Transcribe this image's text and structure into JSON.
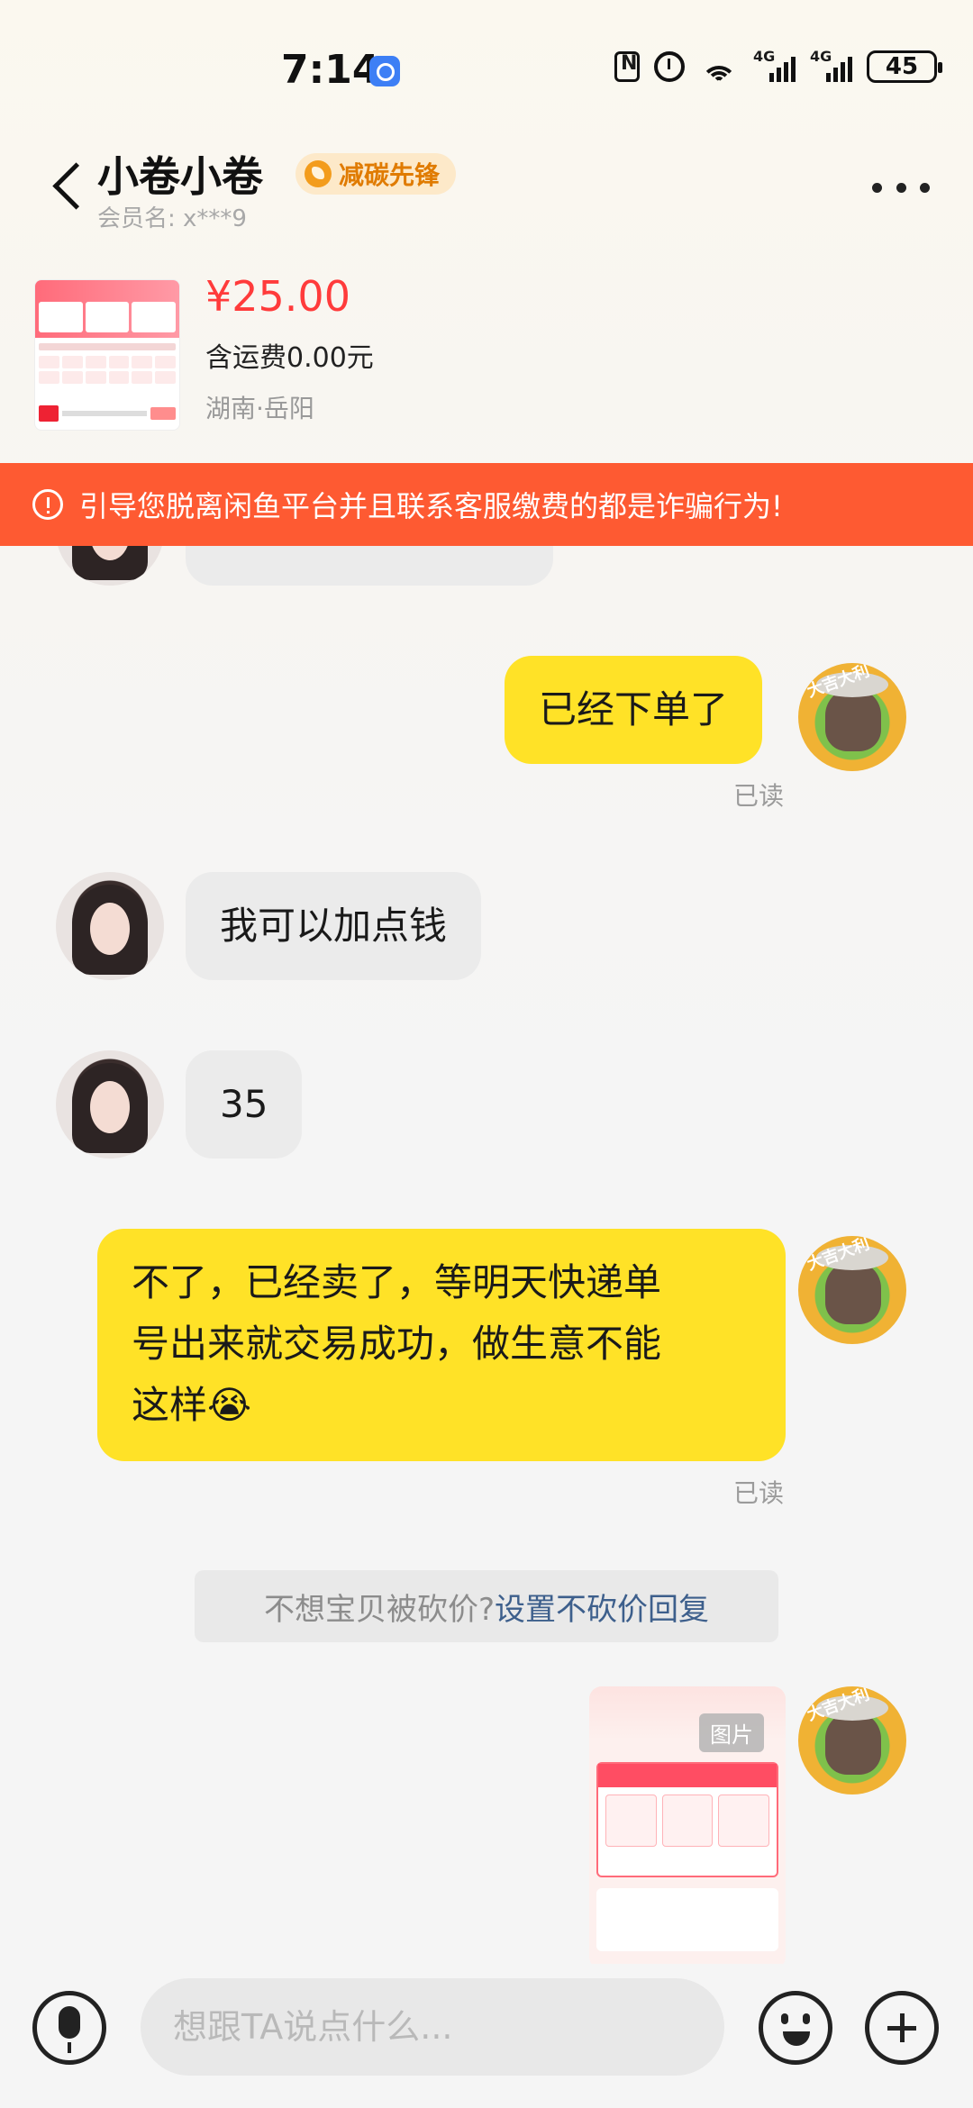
{
  "status_bar": {
    "time": "7:14",
    "signal1_label": "4G",
    "signal2_label": "4G",
    "wifi_label": "6",
    "battery": "45"
  },
  "header": {
    "seller_name": "小卷小卷",
    "badge": "减碳先锋",
    "member_label": "会员名:  x***9"
  },
  "product": {
    "price": "¥25.00",
    "shipping": "含运费0.00元",
    "location": "湖南·岳阳"
  },
  "warning": {
    "text": "引导您脱离闲鱼平台并且联系客服缴费的都是诈骗行为!"
  },
  "messages": {
    "m1": "已经下单了",
    "m1_status": "已读",
    "m2": "我可以加点钱",
    "m3": "35",
    "m4_line1": "不了，已经卖了，等明天快递单",
    "m4_line2": "号出来就交易成功，做生意不能",
    "m4_line3": "这样😭",
    "m4_status": "已读",
    "avatar_ribbon": "大吉大利"
  },
  "system_tip": {
    "text": "不想宝贝被砍价? ",
    "link": "设置不砍价回复"
  },
  "image_message": {
    "tag": "图片"
  },
  "input_bar": {
    "placeholder": "想跟TA说点什么..."
  },
  "colors": {
    "warning_bg": "#fe5a32",
    "outgoing_bubble": "#ffe227",
    "incoming_bubble": "#ebebeb",
    "price": "#ff3b3b",
    "link": "#3d5f8c"
  }
}
